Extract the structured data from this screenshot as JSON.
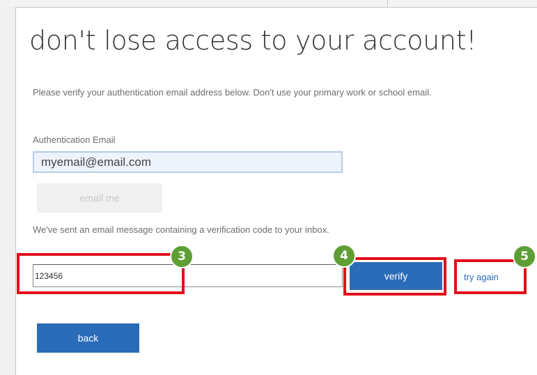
{
  "dialog": {
    "title": "don't lose access to your account!",
    "description": "Please verify your authentication email address below. Don't use your primary work or school email.",
    "email_field": {
      "label": "Authentication Email",
      "value": "myemail@email.com"
    },
    "email_me_label": "email me",
    "sent_message": "We've sent an email message containing a verification code to your inbox.",
    "code_field": {
      "value": "123456"
    },
    "verify_label": "verify",
    "try_again_label": "try again",
    "back_label": "back"
  },
  "annotations": {
    "step_3": "3",
    "step_4": "4",
    "step_5": "5",
    "highlight_color": "#e10f1a",
    "badge_color": "#5e9e35"
  },
  "colors": {
    "primary_button": "#2b6cb8",
    "link": "#2b6cb8",
    "input_highlight_bg": "#eef3fb"
  }
}
